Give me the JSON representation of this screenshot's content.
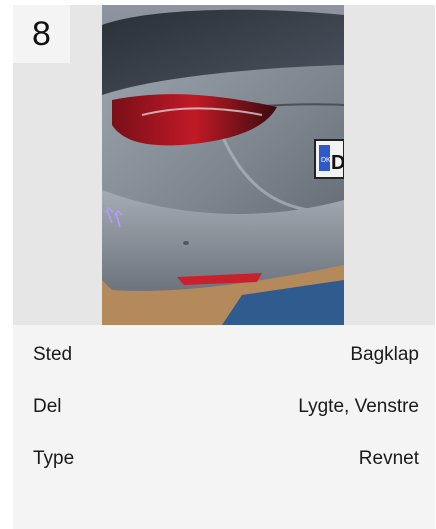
{
  "card": {
    "number": "8",
    "photo": {
      "subject": "rear-left corner of a grey car with red taillight and license plate"
    },
    "details": [
      {
        "label": "Sted",
        "value": "Bagklap"
      },
      {
        "label": "Del",
        "value": "Lygte, Venstre"
      },
      {
        "label": "Type",
        "value": "Revnet"
      }
    ],
    "plate": {
      "country": "DK",
      "text": "D"
    }
  },
  "colors": {
    "card_background": "#e6e6e6",
    "panel_background": "#f4f4f4",
    "text": "#1a1a1a"
  }
}
